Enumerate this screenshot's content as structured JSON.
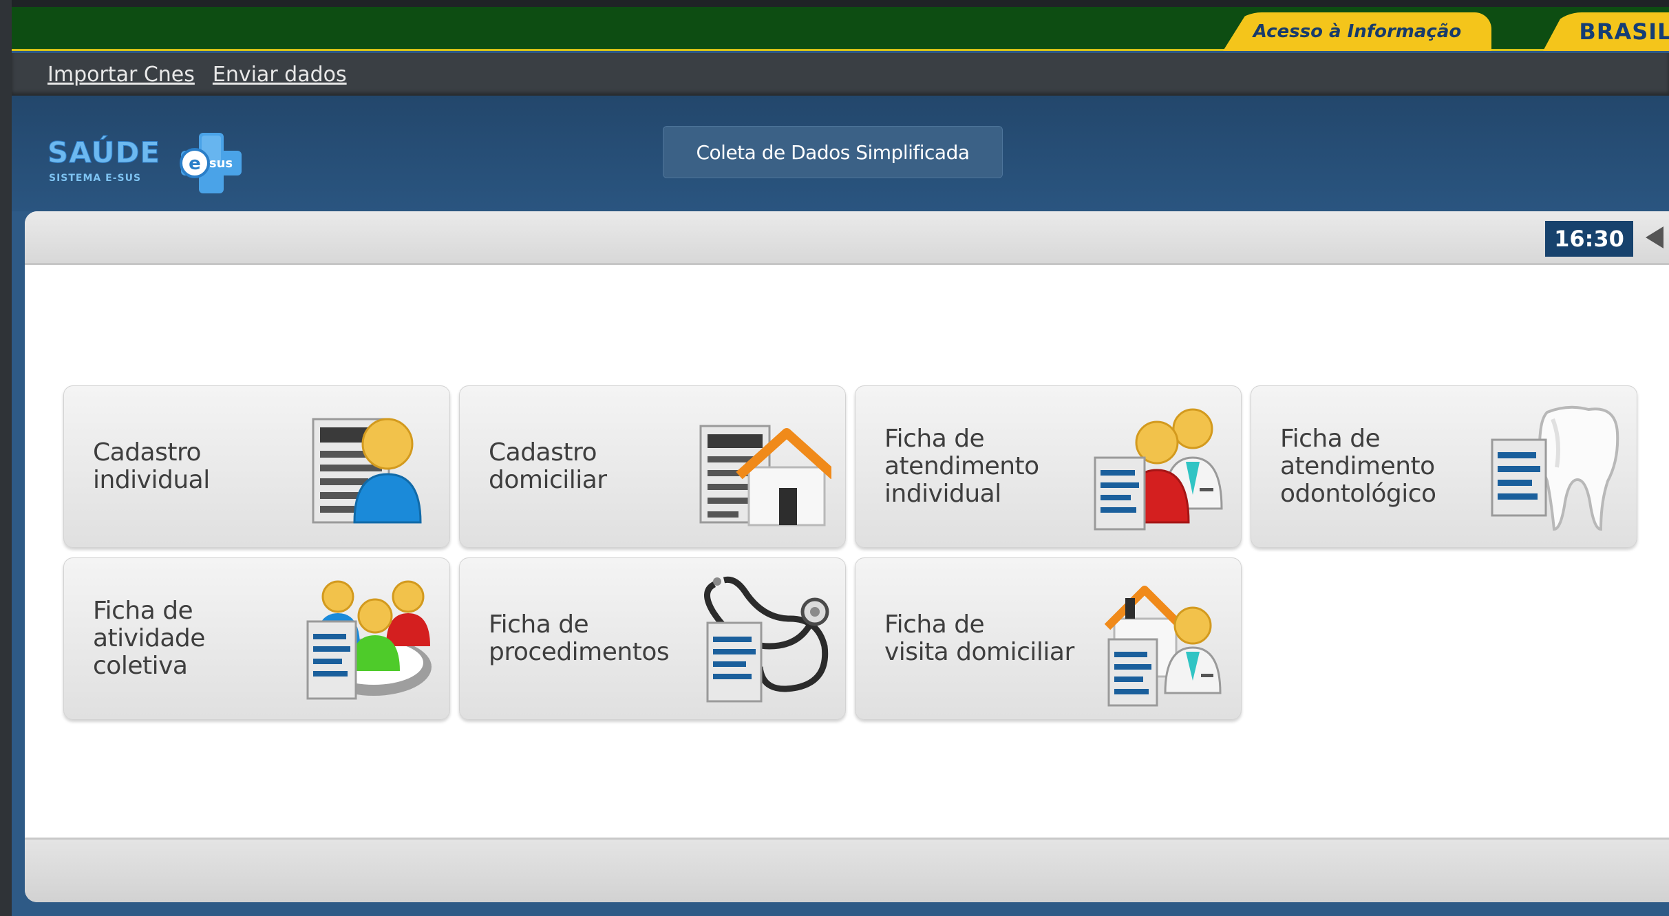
{
  "gov_bar": {
    "access_label": "Acesso à Informação",
    "brasil_label": "BRASIL"
  },
  "links": {
    "import": "Importar Cnes",
    "send": "Enviar dados"
  },
  "header": {
    "logo_title": "SAÚDE",
    "logo_subtitle": "SISTEMA E-SUS",
    "logo_badge": "sus",
    "mode_button": "Coleta de Dados Simplificada"
  },
  "toolbar": {
    "clock": "16:30"
  },
  "tiles": [
    {
      "label": "Cadastro\nindividual",
      "icon": "person-form-icon"
    },
    {
      "label": "Cadastro\ndomiciliar",
      "icon": "house-form-icon"
    },
    {
      "label": "Ficha de\natendimento\nindividual",
      "icon": "doctor-patient-icon"
    },
    {
      "label": "Ficha de\natendimento\nodontológico",
      "icon": "tooth-icon"
    },
    {
      "label": "Ficha de\natividade\ncoletiva",
      "icon": "group-icon"
    },
    {
      "label": "Ficha de\nprocedimentos",
      "icon": "stethoscope-icon"
    },
    {
      "label": "Ficha de\nvisita domiciliar",
      "icon": "home-visit-icon"
    }
  ]
}
